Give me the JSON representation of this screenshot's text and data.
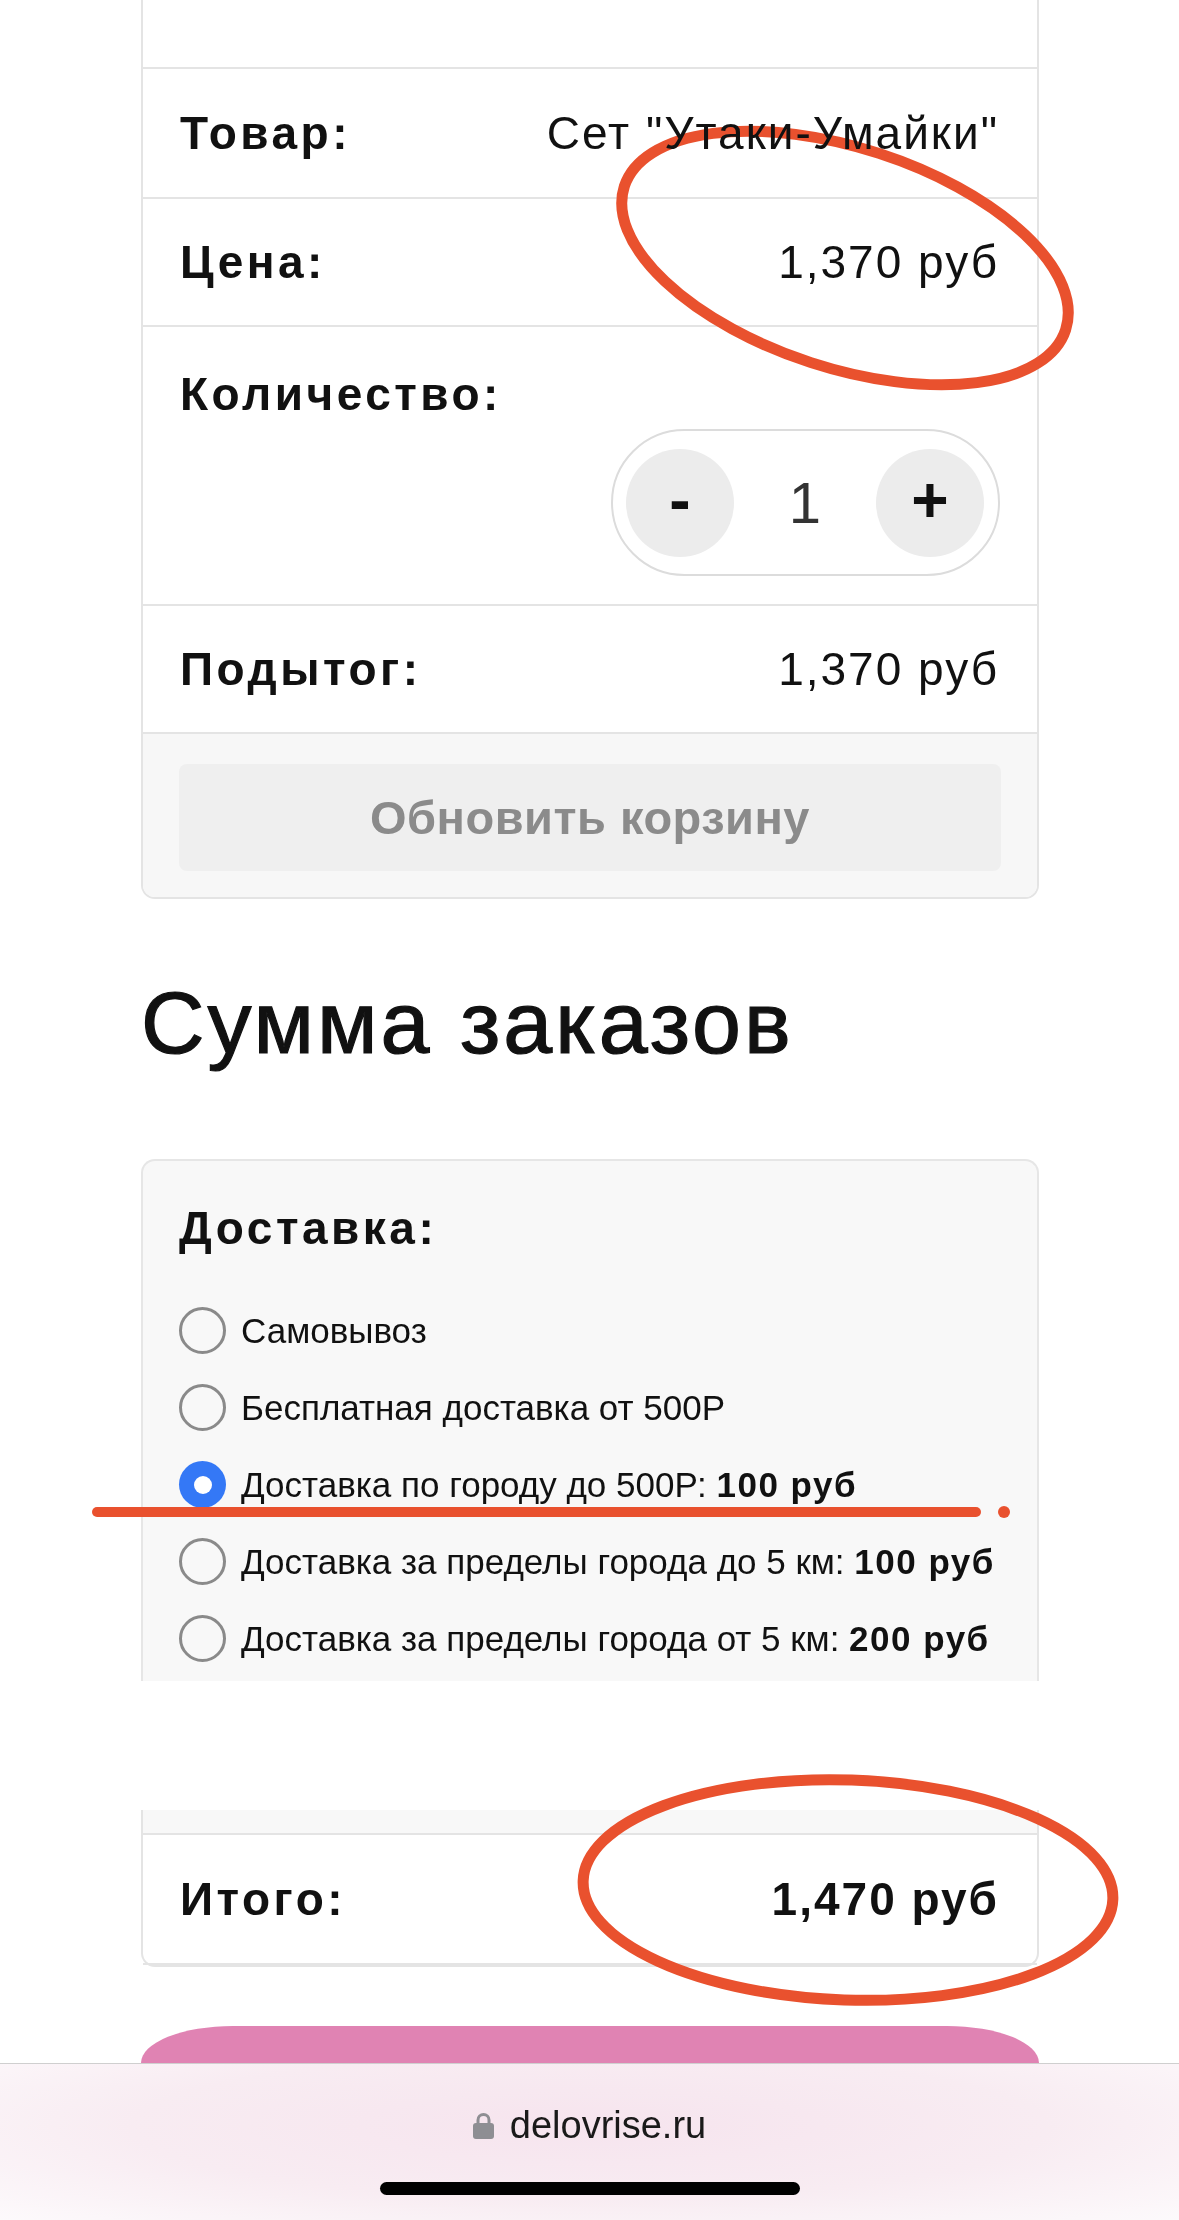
{
  "cart": {
    "rows": [
      {
        "kind": "text",
        "label": "Товар:",
        "value": "Сет \"Утаки-Умайки\"",
        "circled": false
      },
      {
        "kind": "text",
        "label": "Цена:",
        "value": "1,370 руб",
        "circled": true
      },
      {
        "kind": "quantity",
        "label": "Количество:",
        "decrement": "-",
        "value": "1",
        "increment": "+",
        "circled": false
      },
      {
        "kind": "text",
        "label": "Подытог:",
        "value": "1,370 руб",
        "circled": false
      }
    ],
    "update_button": {
      "label": "Обновить корзину",
      "disabled": true
    }
  },
  "order_totals": {
    "title": "Сумма заказов",
    "shipping": {
      "label": "Доставка:",
      "options": [
        {
          "label": "Самовывоз",
          "selected": false,
          "underlined": false
        },
        {
          "label": "Бесплатная доставка от 500Р",
          "selected": false,
          "underlined": false
        },
        {
          "label": "Доставка по городу до 500Р: **100 руб**",
          "selected": true,
          "underlined": true
        },
        {
          "label": "Доставка за пределы города до 5 км: **100 руб**",
          "selected": false,
          "underlined": false
        },
        {
          "label": "Доставка за пределы города от 5 км: **200 руб**",
          "selected": false,
          "underlined": false
        }
      ]
    },
    "total": {
      "label": "Итого:",
      "value": "1,470 руб",
      "circled": true
    }
  },
  "browser_bar": {
    "url": "delovrise.ru"
  }
}
